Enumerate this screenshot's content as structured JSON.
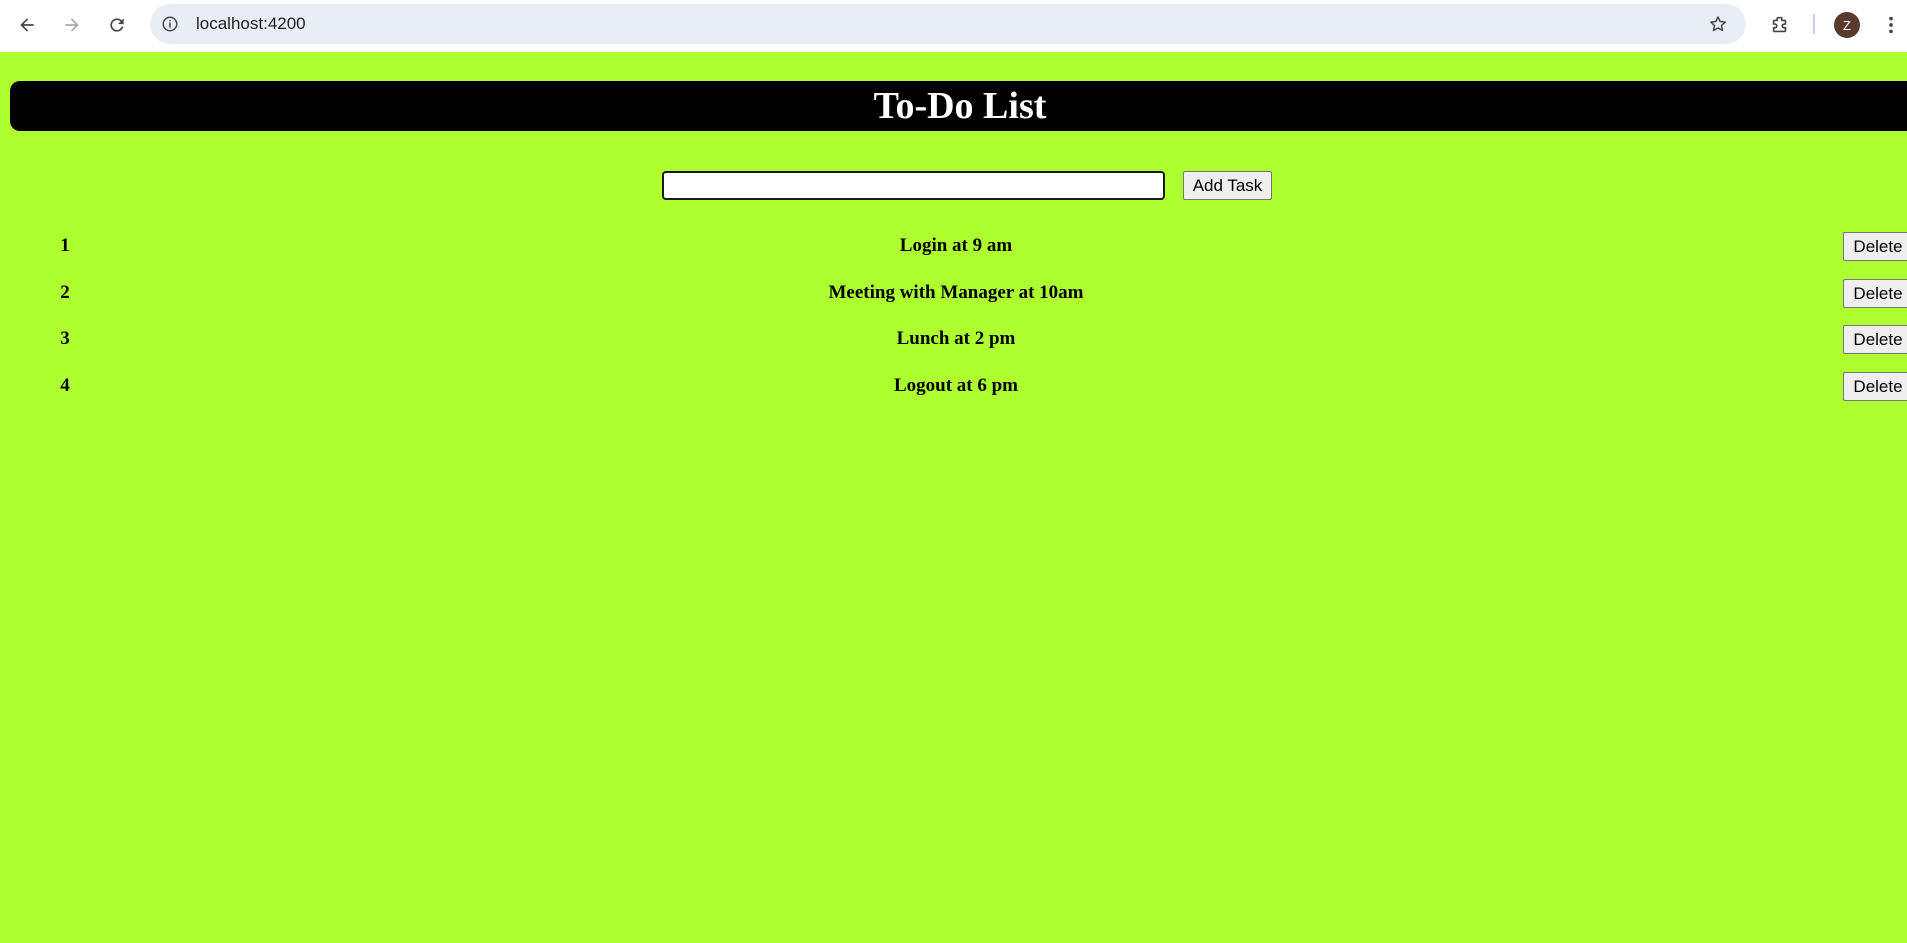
{
  "browser": {
    "url": "localhost:4200",
    "profile_initial": "Z",
    "icons": [
      "back-icon",
      "forward-icon",
      "reload-icon",
      "site-info-icon",
      "bookmark-star-icon",
      "extensions-icon",
      "kebab-menu-icon"
    ]
  },
  "page": {
    "background_color": "#adff2f",
    "title": "To-Do List",
    "input_value": "",
    "add_button_label": "Add Task",
    "tasks": [
      {
        "number": "1",
        "text": "Login at 9 am",
        "delete_label": "Delete"
      },
      {
        "number": "2",
        "text": "Meeting with Manager at 10am",
        "delete_label": "Delete"
      },
      {
        "number": "3",
        "text": "Lunch at 2 pm",
        "delete_label": "Delete"
      },
      {
        "number": "4",
        "text": "Logout at 6 pm",
        "delete_label": "Delete"
      }
    ]
  }
}
